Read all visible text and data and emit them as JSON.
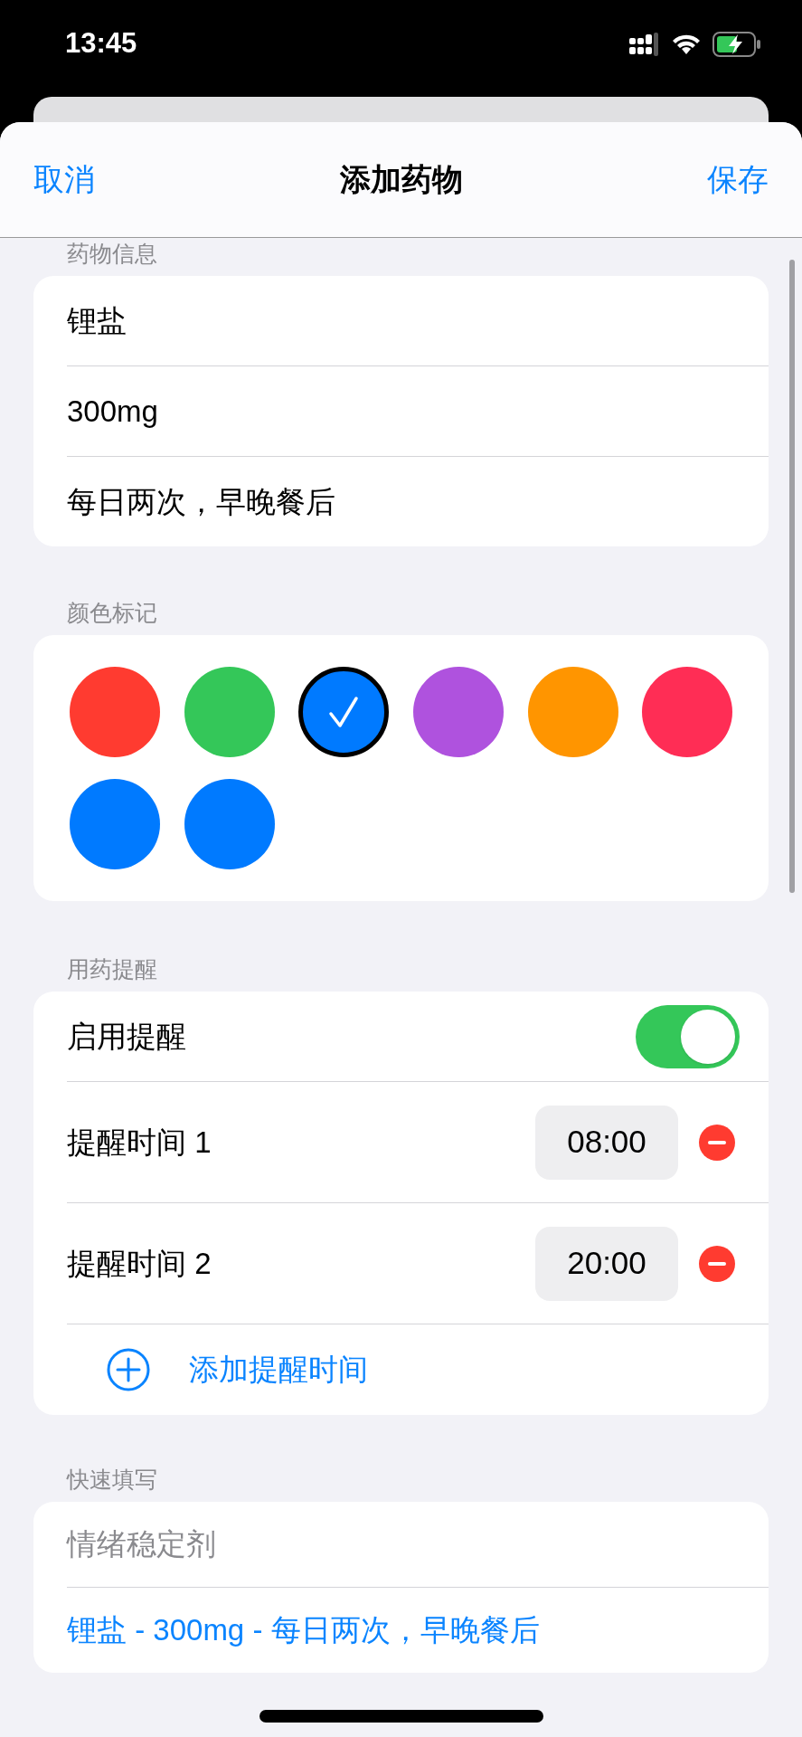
{
  "status_bar": {
    "time": "13:45"
  },
  "nav": {
    "cancel": "取消",
    "title": "添加药物",
    "save": "保存"
  },
  "sections": [
    {
      "kind": "fields",
      "header": "药物信息",
      "rows": [
        {
          "value": "锂盐"
        },
        {
          "value": "300mg"
        },
        {
          "value": "每日两次，早晚餐后"
        }
      ]
    },
    {
      "kind": "colors",
      "header": "颜色标记",
      "colors": [
        {
          "color": "#ff3b30",
          "selected": false
        },
        {
          "color": "#34c759",
          "selected": false
        },
        {
          "color": "#007aff",
          "selected": true
        },
        {
          "color": "#af52de",
          "selected": false
        },
        {
          "color": "#ff9500",
          "selected": false
        },
        {
          "color": "#ff2d55",
          "selected": false
        },
        {
          "color": "#007aff",
          "selected": false
        },
        {
          "color": "#007aff",
          "selected": false
        }
      ]
    },
    {
      "kind": "reminders",
      "header": "用药提醒",
      "toggle": {
        "label": "启用提醒",
        "on": true
      },
      "times": [
        {
          "label": "提醒时间 1",
          "time": "08:00"
        },
        {
          "label": "提醒时间 2",
          "time": "20:00"
        }
      ],
      "add_label": "添加提醒时间"
    },
    {
      "kind": "quick",
      "header": "快速填写",
      "rows": [
        {
          "kind": "category",
          "text": "情绪稳定剂"
        },
        {
          "kind": "preset",
          "text": "锂盐 - 300mg - 每日两次，早晚餐后"
        }
      ]
    }
  ]
}
